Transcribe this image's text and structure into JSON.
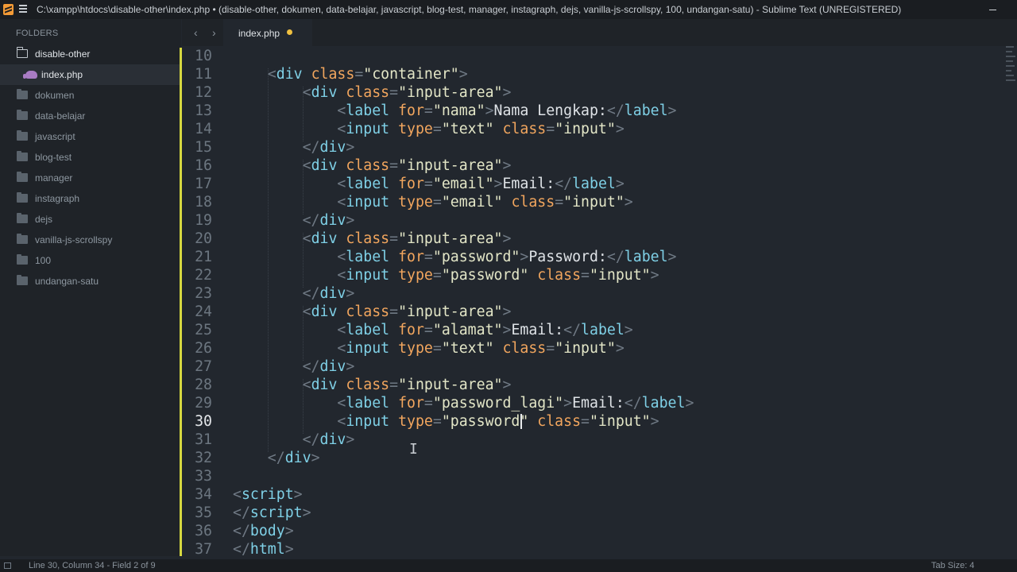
{
  "window": {
    "title": "C:\\xampp\\htdocs\\disable-other\\index.php • (disable-other, dokumen, data-belajar, javascript, blog-test, manager, instagraph, dejs, vanilla-js-scrollspy, 100, undangan-satu) - Sublime Text (UNREGISTERED)"
  },
  "sidebar": {
    "header": "FOLDERS",
    "open_folder": "disable-other",
    "active_file": "index.php",
    "folders": [
      "dokumen",
      "data-belajar",
      "javascript",
      "blog-test",
      "manager",
      "instagraph",
      "dejs",
      "vanilla-js-scrollspy",
      "100",
      "undangan-satu"
    ]
  },
  "tabs": {
    "prev": "‹",
    "next": "›",
    "active_label": "index.php"
  },
  "editor": {
    "current_line": "30",
    "lines": [
      {
        "n": "10",
        "t": []
      },
      {
        "n": "11",
        "t": [
          [
            "br",
            "    <"
          ],
          [
            "tg",
            "div"
          ],
          [
            "tx",
            " "
          ],
          [
            "at",
            "class"
          ],
          [
            "br",
            "="
          ],
          [
            "sv",
            "\"container\""
          ],
          [
            "br",
            ">"
          ]
        ]
      },
      {
        "n": "12",
        "t": [
          [
            "br",
            "        <"
          ],
          [
            "tg",
            "div"
          ],
          [
            "tx",
            " "
          ],
          [
            "at",
            "class"
          ],
          [
            "br",
            "="
          ],
          [
            "sv",
            "\"input-area\""
          ],
          [
            "br",
            ">"
          ]
        ]
      },
      {
        "n": "13",
        "t": [
          [
            "br",
            "            <"
          ],
          [
            "tg",
            "label"
          ],
          [
            "tx",
            " "
          ],
          [
            "at",
            "for"
          ],
          [
            "br",
            "="
          ],
          [
            "sv",
            "\"nama\""
          ],
          [
            "br",
            ">"
          ],
          [
            "tx",
            "Nama Lengkap:"
          ],
          [
            "br",
            "</"
          ],
          [
            "tg",
            "label"
          ],
          [
            "br",
            ">"
          ]
        ]
      },
      {
        "n": "14",
        "t": [
          [
            "br",
            "            <"
          ],
          [
            "tg",
            "input"
          ],
          [
            "tx",
            " "
          ],
          [
            "at",
            "type"
          ],
          [
            "br",
            "="
          ],
          [
            "sv",
            "\"text\""
          ],
          [
            "tx",
            " "
          ],
          [
            "at",
            "class"
          ],
          [
            "br",
            "="
          ],
          [
            "sv",
            "\"input\""
          ],
          [
            "br",
            ">"
          ]
        ]
      },
      {
        "n": "15",
        "t": [
          [
            "br",
            "        </"
          ],
          [
            "tg",
            "div"
          ],
          [
            "br",
            ">"
          ]
        ]
      },
      {
        "n": "16",
        "t": [
          [
            "br",
            "        <"
          ],
          [
            "tg",
            "div"
          ],
          [
            "tx",
            " "
          ],
          [
            "at",
            "class"
          ],
          [
            "br",
            "="
          ],
          [
            "sv",
            "\"input-area\""
          ],
          [
            "br",
            ">"
          ]
        ]
      },
      {
        "n": "17",
        "t": [
          [
            "br",
            "            <"
          ],
          [
            "tg",
            "label"
          ],
          [
            "tx",
            " "
          ],
          [
            "at",
            "for"
          ],
          [
            "br",
            "="
          ],
          [
            "sv",
            "\"email\""
          ],
          [
            "br",
            ">"
          ],
          [
            "tx",
            "Email:"
          ],
          [
            "br",
            "</"
          ],
          [
            "tg",
            "label"
          ],
          [
            "br",
            ">"
          ]
        ]
      },
      {
        "n": "18",
        "t": [
          [
            "br",
            "            <"
          ],
          [
            "tg",
            "input"
          ],
          [
            "tx",
            " "
          ],
          [
            "at",
            "type"
          ],
          [
            "br",
            "="
          ],
          [
            "sv",
            "\"email\""
          ],
          [
            "tx",
            " "
          ],
          [
            "at",
            "class"
          ],
          [
            "br",
            "="
          ],
          [
            "sv",
            "\"input\""
          ],
          [
            "br",
            ">"
          ]
        ]
      },
      {
        "n": "19",
        "t": [
          [
            "br",
            "        </"
          ],
          [
            "tg",
            "div"
          ],
          [
            "br",
            ">"
          ]
        ]
      },
      {
        "n": "20",
        "t": [
          [
            "br",
            "        <"
          ],
          [
            "tg",
            "div"
          ],
          [
            "tx",
            " "
          ],
          [
            "at",
            "class"
          ],
          [
            "br",
            "="
          ],
          [
            "sv",
            "\"input-area\""
          ],
          [
            "br",
            ">"
          ]
        ]
      },
      {
        "n": "21",
        "t": [
          [
            "br",
            "            <"
          ],
          [
            "tg",
            "label"
          ],
          [
            "tx",
            " "
          ],
          [
            "at",
            "for"
          ],
          [
            "br",
            "="
          ],
          [
            "sv",
            "\"password\""
          ],
          [
            "br",
            ">"
          ],
          [
            "tx",
            "Password:"
          ],
          [
            "br",
            "</"
          ],
          [
            "tg",
            "label"
          ],
          [
            "br",
            ">"
          ]
        ]
      },
      {
        "n": "22",
        "t": [
          [
            "br",
            "            <"
          ],
          [
            "tg",
            "input"
          ],
          [
            "tx",
            " "
          ],
          [
            "at",
            "type"
          ],
          [
            "br",
            "="
          ],
          [
            "sv",
            "\"password\""
          ],
          [
            "tx",
            " "
          ],
          [
            "at",
            "class"
          ],
          [
            "br",
            "="
          ],
          [
            "sv",
            "\"input\""
          ],
          [
            "br",
            ">"
          ]
        ]
      },
      {
        "n": "23",
        "t": [
          [
            "br",
            "        </"
          ],
          [
            "tg",
            "div"
          ],
          [
            "br",
            ">"
          ]
        ]
      },
      {
        "n": "24",
        "t": [
          [
            "br",
            "        <"
          ],
          [
            "tg",
            "div"
          ],
          [
            "tx",
            " "
          ],
          [
            "at",
            "class"
          ],
          [
            "br",
            "="
          ],
          [
            "sv",
            "\"input-area\""
          ],
          [
            "br",
            ">"
          ]
        ]
      },
      {
        "n": "25",
        "t": [
          [
            "br",
            "            <"
          ],
          [
            "tg",
            "label"
          ],
          [
            "tx",
            " "
          ],
          [
            "at",
            "for"
          ],
          [
            "br",
            "="
          ],
          [
            "sv",
            "\"alamat\""
          ],
          [
            "br",
            ">"
          ],
          [
            "tx",
            "Email:"
          ],
          [
            "br",
            "</"
          ],
          [
            "tg",
            "label"
          ],
          [
            "br",
            ">"
          ]
        ]
      },
      {
        "n": "26",
        "t": [
          [
            "br",
            "            <"
          ],
          [
            "tg",
            "input"
          ],
          [
            "tx",
            " "
          ],
          [
            "at",
            "type"
          ],
          [
            "br",
            "="
          ],
          [
            "sv",
            "\"text\""
          ],
          [
            "tx",
            " "
          ],
          [
            "at",
            "class"
          ],
          [
            "br",
            "="
          ],
          [
            "sv",
            "\"input\""
          ],
          [
            "br",
            ">"
          ]
        ]
      },
      {
        "n": "27",
        "t": [
          [
            "br",
            "        </"
          ],
          [
            "tg",
            "div"
          ],
          [
            "br",
            ">"
          ]
        ]
      },
      {
        "n": "28",
        "t": [
          [
            "br",
            "        <"
          ],
          [
            "tg",
            "div"
          ],
          [
            "tx",
            " "
          ],
          [
            "at",
            "class"
          ],
          [
            "br",
            "="
          ],
          [
            "sv",
            "\"input-area\""
          ],
          [
            "br",
            ">"
          ]
        ]
      },
      {
        "n": "29",
        "t": [
          [
            "br",
            "            <"
          ],
          [
            "tg",
            "label"
          ],
          [
            "tx",
            " "
          ],
          [
            "at",
            "for"
          ],
          [
            "br",
            "="
          ],
          [
            "sv",
            "\"password_lagi\""
          ],
          [
            "br",
            ">"
          ],
          [
            "tx",
            "Email:"
          ],
          [
            "br",
            "</"
          ],
          [
            "tg",
            "label"
          ],
          [
            "br",
            ">"
          ]
        ]
      },
      {
        "n": "30",
        "t": [
          [
            "br",
            "            <"
          ],
          [
            "tg",
            "input"
          ],
          [
            "tx",
            " "
          ],
          [
            "at",
            "type"
          ],
          [
            "br",
            "="
          ],
          [
            "sv",
            "\"password\""
          ],
          [
            "tx",
            " "
          ],
          [
            "at",
            "class"
          ],
          [
            "br",
            "="
          ],
          [
            "sv",
            "\"input\""
          ],
          [
            "br",
            ">"
          ]
        ]
      },
      {
        "n": "31",
        "t": [
          [
            "br",
            "        </"
          ],
          [
            "tg",
            "div"
          ],
          [
            "br",
            ">"
          ]
        ]
      },
      {
        "n": "32",
        "t": [
          [
            "br",
            "    </"
          ],
          [
            "tg",
            "div"
          ],
          [
            "br",
            ">"
          ]
        ]
      },
      {
        "n": "33",
        "t": []
      },
      {
        "n": "34",
        "t": [
          [
            "br",
            "<"
          ],
          [
            "tg",
            "script"
          ],
          [
            "br",
            ">"
          ]
        ]
      },
      {
        "n": "35",
        "t": [
          [
            "br",
            "</"
          ],
          [
            "tg",
            "script"
          ],
          [
            "br",
            ">"
          ]
        ]
      },
      {
        "n": "36",
        "t": [
          [
            "br",
            "</"
          ],
          [
            "tg",
            "body"
          ],
          [
            "br",
            ">"
          ]
        ]
      },
      {
        "n": "37",
        "t": [
          [
            "br",
            "</"
          ],
          [
            "tg",
            "html"
          ],
          [
            "br",
            ">"
          ]
        ]
      }
    ]
  },
  "statusbar": {
    "position": "Line 30, Column 34 - Field 2 of 9",
    "tab_size": "Tab Size: 4"
  }
}
